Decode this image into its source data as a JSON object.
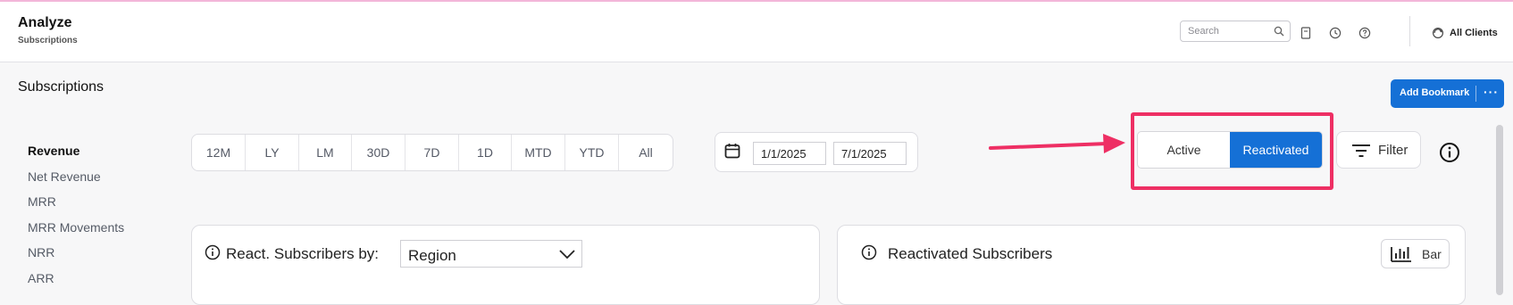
{
  "header": {
    "title": "Analyze",
    "subtitle": "Subscriptions",
    "search_placeholder": "Search",
    "all_clients_label": "All Clients",
    "icons": [
      "bookmark-icon",
      "history-icon",
      "help-icon",
      "clients-icon"
    ]
  },
  "page": {
    "title": "Subscriptions",
    "add_bookmark_label": "Add Bookmark",
    "more_label": "···"
  },
  "nav": {
    "items": [
      {
        "label": "Revenue",
        "active": true
      },
      {
        "label": "Net Revenue"
      },
      {
        "label": "MRR"
      },
      {
        "label": "MRR Movements"
      },
      {
        "label": "NRR"
      },
      {
        "label": "ARR"
      }
    ]
  },
  "range": {
    "options": [
      "12M",
      "LY",
      "LM",
      "30D",
      "7D",
      "1D",
      "MTD",
      "YTD",
      "All"
    ]
  },
  "dates": {
    "start": "1/1/2025",
    "end": "7/1/2025"
  },
  "toggle": {
    "options": [
      "Active",
      "Reactivated"
    ],
    "selected": "Reactivated"
  },
  "filter_label": "Filter",
  "cards": [
    {
      "title": "React. Subscribers by:",
      "select_value": "Region"
    },
    {
      "title": "Reactivated Subscribers",
      "chart_type_label": "Bar"
    }
  ],
  "colors": {
    "accent": "#1570d6",
    "highlight": "#ee2f64",
    "background": "#f7f7f8"
  }
}
